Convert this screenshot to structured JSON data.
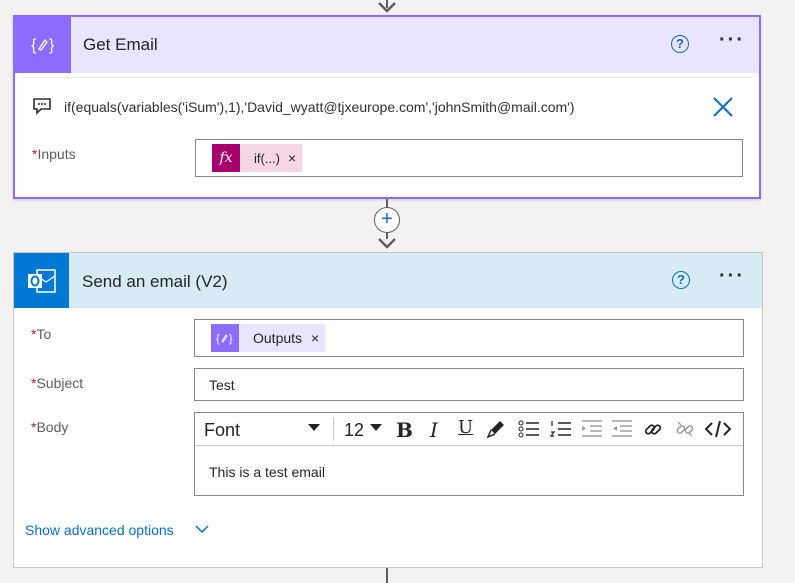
{
  "card1": {
    "title": "Get Email",
    "help": "?",
    "more": "···",
    "expression": "if(equals(variables('iSum'),1),'David_wyatt@tjxeurope.com','johnSmith@mail.com')",
    "inputs_label": "Inputs",
    "required_mark": "*",
    "token_label": "if(...)",
    "token_icon": "fx",
    "token_remove": "×",
    "accent_color": "#8c6cfc",
    "token_color": "#a5006e"
  },
  "add_button": "+",
  "card2": {
    "title": "Send an email (V2)",
    "help": "?",
    "more": "···",
    "to_label": "To",
    "to_token": "Outputs",
    "to_token_remove": "×",
    "subject_label": "Subject",
    "subject_value": "Test",
    "body_label": "Body",
    "toolbar": {
      "font": "Font",
      "size": "12",
      "bold": "B",
      "italic": "I",
      "underline": "U"
    },
    "body_text": "This is a test email",
    "advanced_link": "Show advanced options",
    "header_color": "#d9eaf7",
    "outlook_color": "#0078d4"
  }
}
